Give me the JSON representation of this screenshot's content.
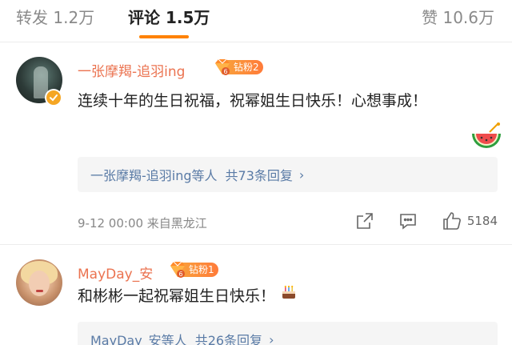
{
  "tabs": {
    "repost": "转发 1.2万",
    "comments": "评论 1.5万",
    "likes": "赞 10.6万"
  },
  "colors": {
    "accent": "#ff8200",
    "username": "#eb7350",
    "link": "#5a7ba6",
    "badge": "#f9a23b"
  },
  "comments": [
    {
      "username": "一张摩羯-追羽ing",
      "fan_badge": "钻粉2",
      "fan_level": "6",
      "text": "连续十年的生日祝福，祝幂姐生日快乐！心想事成！",
      "sticker": "watermelon-icon",
      "reply_summary": "一张摩羯-追羽ing等人",
      "reply_count": "共73条回复",
      "meta": "9-12 00:00  来自黑龙江",
      "like_count": "5184"
    },
    {
      "username": "MayDay_安",
      "fan_badge": "钻粉1",
      "fan_level": "6",
      "text": "和彬彬一起祝幂姐生日快乐！",
      "sticker": "cake-icon",
      "reply_summary": "MayDay_安等人",
      "reply_count": "共26条回复"
    }
  ]
}
